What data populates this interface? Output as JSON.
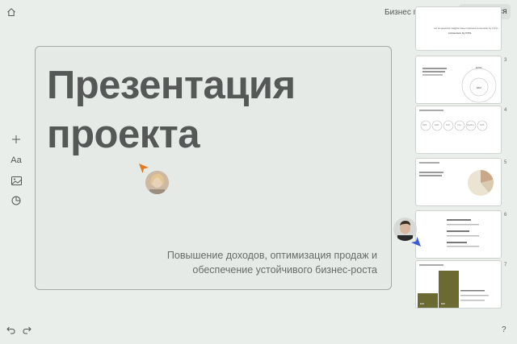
{
  "topbar": {
    "home_icon": "home-icon",
    "presentation_title": "Бизнес презентация",
    "share_label": "Поделиться"
  },
  "main_slide": {
    "title_line1": "Презентация",
    "title_line2": "проекта",
    "subtitle_line1": "Повышение доходов, оптимизация продаж и",
    "subtitle_line2": "обеспечение устойчивого бизнес-роста"
  },
  "tools": [
    "plus-icon",
    "text-icon",
    "image-icon",
    "chart-icon"
  ],
  "tools_text_label": "Aa",
  "bottom": {
    "undo_icon": "undo-icon",
    "redo_icon": "redo-icon",
    "help_label": "?"
  },
  "thumbnails": {
    "numbers": [
      "3",
      "4",
      "5",
      "6",
      "7"
    ],
    "slide2_text_line1": "our AI-powered insights have improved conversion by 3.2%...",
    "slide2_text_line2": "conversion by 0.5%.",
    "slide3_values": [
      "$15M",
      "$8M"
    ],
    "slide4_labels": [
      "NDS",
      "ARR",
      "TAS",
      "CAC",
      "Pipeline",
      "SMS"
    ],
    "slide7_labels": [
      "$2M",
      "$8M"
    ]
  },
  "colors": {
    "background": "#eaeeeb",
    "olive": "#6b6a33",
    "tan": "#c9a88a",
    "cursor_orange": "#e07a20",
    "cursor_blue": "#3a5ad8"
  }
}
